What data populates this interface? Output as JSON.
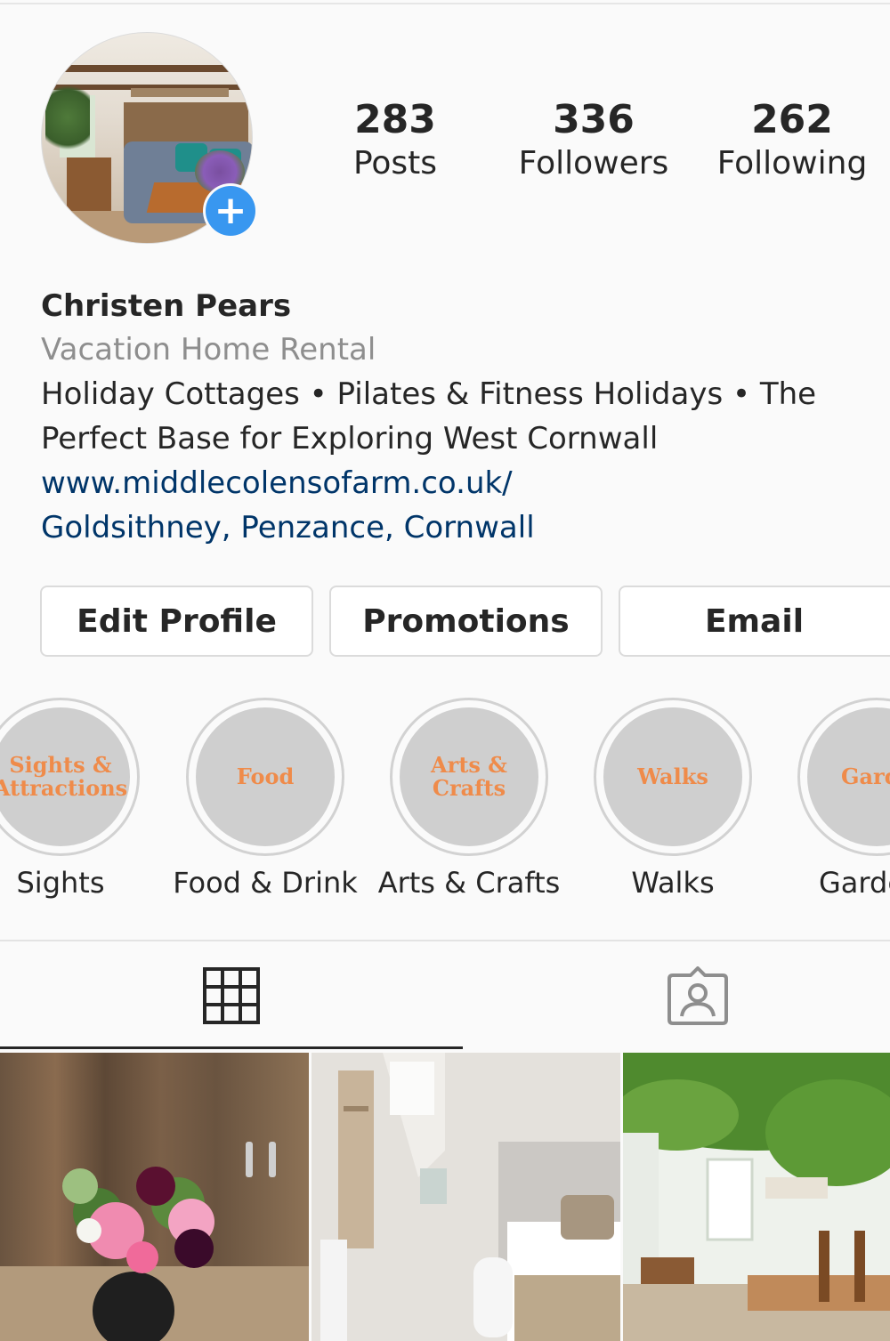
{
  "profile": {
    "name": "Christen Pears",
    "category": "Vacation Home Rental",
    "bio_line1": "Holiday Cottages • Pilates & Fitness Holidays • The",
    "bio_line2": "Perfect Base for Exploring West Cornwall",
    "website": "www.middlecolensofarm.co.uk/",
    "location": "Goldsithney, Penzance, Cornwall",
    "avatar_icon": "avatar-photo",
    "add_story_icon": "plus-icon",
    "add_story_symbol": "+"
  },
  "stats": [
    {
      "value": "283",
      "label": "Posts"
    },
    {
      "value": "336",
      "label": "Followers"
    },
    {
      "value": "262",
      "label": "Following"
    }
  ],
  "actions": {
    "edit_profile": "Edit Profile",
    "promotions": "Promotions",
    "email": "Email"
  },
  "highlights": [
    {
      "cover_line1": "Sights &",
      "cover_line2": "Attractions",
      "label": "Sights"
    },
    {
      "cover_line1": "Food",
      "cover_line2": "",
      "label": "Food & Drink"
    },
    {
      "cover_line1": "Arts &",
      "cover_line2": "Crafts",
      "label": "Arts & Crafts"
    },
    {
      "cover_line1": "Walks",
      "cover_line2": "",
      "label": "Walks"
    },
    {
      "cover_line1": "Garde",
      "cover_line2": "",
      "label": "Garde"
    }
  ],
  "tabs": [
    {
      "icon": "grid-icon",
      "active": true
    },
    {
      "icon": "tagged-person-icon",
      "active": false
    }
  ],
  "posts": [
    {
      "subject": "flowers-in-vase-photo"
    },
    {
      "subject": "bedroom-photo"
    },
    {
      "subject": "greenhouse-cafe-photo"
    }
  ],
  "colors": {
    "background": "#fafafa",
    "accent_blue": "#3897f0",
    "link": "#003569",
    "muted": "#8e8e8e",
    "highlight_text": "#ef8b4a"
  }
}
